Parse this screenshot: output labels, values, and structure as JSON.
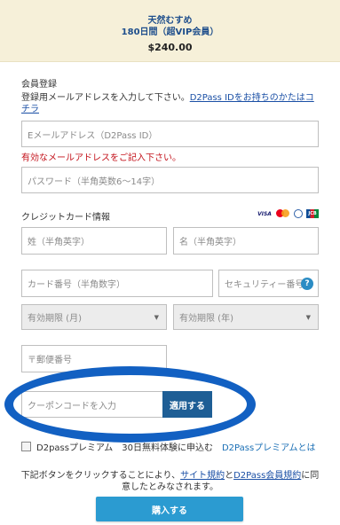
{
  "plan": {
    "name": "天然むすめ",
    "term": "180日間（超VIP会員）",
    "price": "$240.00"
  },
  "membership": {
    "section_title": "会員登録",
    "note_prefix": "登録用メールアドレスを入力して下さい。",
    "note_link": "D2Pass IDをお持ちのかたはコチラ",
    "email_placeholder": "Eメールアドレス（D2Pass ID）",
    "email_error": "有効なメールアドレスをご記入下さい。",
    "password_placeholder": "パスワード（半角英数6〜14字）"
  },
  "credit_card": {
    "section_title": "クレジットカード情報",
    "brand_icons": [
      "visa-icon",
      "mastercard-icon",
      "diners-icon",
      "jcb-icon"
    ],
    "last_name_placeholder": "姓（半角英字）",
    "first_name_placeholder": "名（半角英字）",
    "card_number_placeholder": "カード番号（半角数字）",
    "security_code_placeholder": "セキュリティー番号",
    "help_label": "?",
    "exp_month_value": "有効期限 (月)",
    "exp_year_value": "有効期限 (年)",
    "postal_code_placeholder": "〒郵便番号"
  },
  "coupon": {
    "placeholder": "クーポンコードを入力",
    "apply_label": "適用する"
  },
  "premium": {
    "checkbox_label": "D2passプレミアム　30日無料体験に申込む",
    "link_label": "D2Passプレミアムとは"
  },
  "terms": {
    "prefix": "下記ボタンをクリックすることにより、",
    "site_terms": "サイト規約",
    "and": "と",
    "member_terms": "D2Pass会員規約",
    "suffix": "に同意したとみなされます。"
  },
  "purchase": {
    "label": "購入する"
  },
  "colors": {
    "accent": "#2b9bd1",
    "apply_button": "#1e5e95",
    "error": "#c3111a",
    "highlight": "#1260c2",
    "plan_bg": "#f6f0d9"
  }
}
